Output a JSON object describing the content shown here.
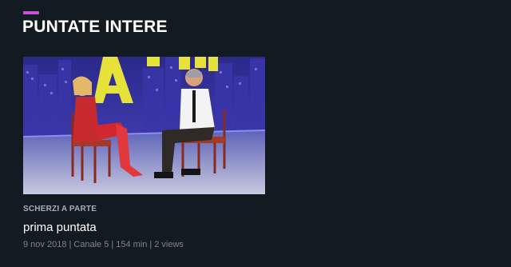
{
  "section": {
    "title": "PUNTATE INTERE",
    "accent_color": "#c552d9"
  },
  "episode": {
    "program": "SCHERZI A PARTE",
    "title": "prima puntata",
    "date": "9 nov 2018",
    "channel": "Canale 5",
    "duration": "154 min",
    "views": "2 views",
    "separator": "|",
    "thumbnail_icon": "video-thumbnail"
  }
}
